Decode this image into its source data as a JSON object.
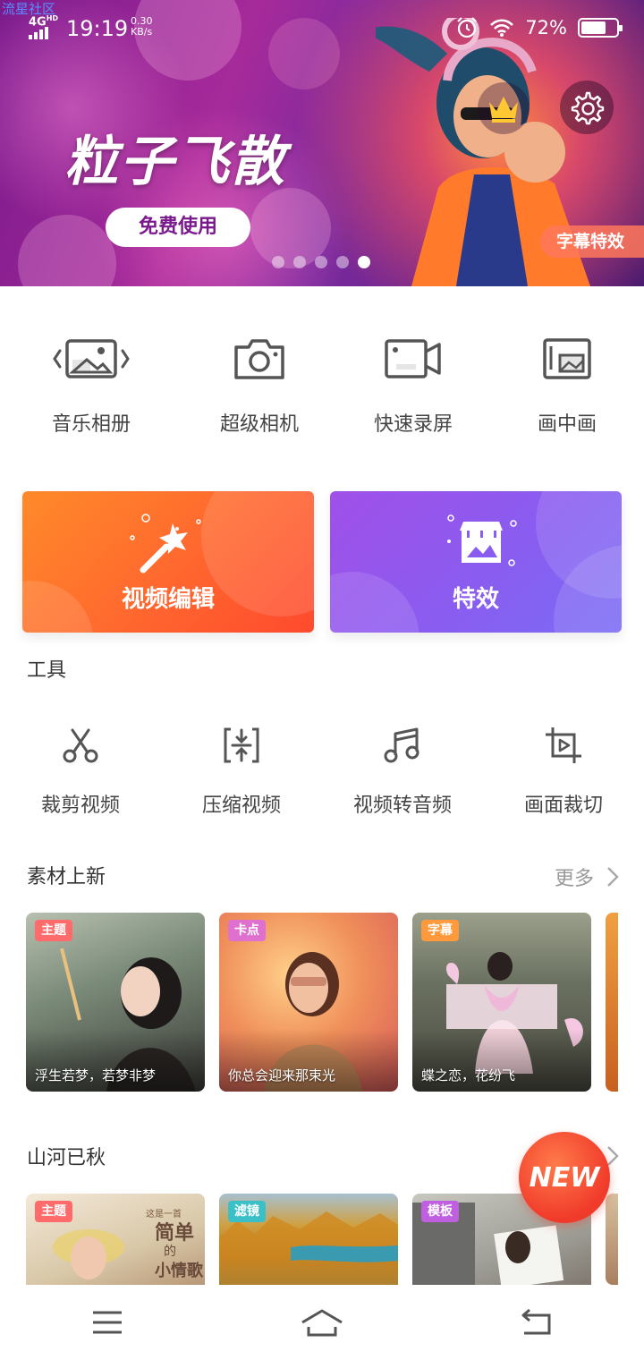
{
  "watermark": "流星社区",
  "status_bar": {
    "network": "4G",
    "network_sup": "HD",
    "time": "19:19",
    "speed_value": "0.30",
    "speed_unit": "KB/s",
    "battery": "72%",
    "battery_level": 0.72,
    "icons": [
      "signal-icon",
      "alarm-icon",
      "wifi-icon",
      "battery-icon"
    ]
  },
  "banner": {
    "title": "粒子飞散",
    "button": "免费使用",
    "tag": "字幕特效",
    "slide_count": 5,
    "active_slide": 5,
    "icons": [
      "crown-icon",
      "gear-icon"
    ]
  },
  "quick_tools": [
    {
      "label": "音乐相册",
      "icon": "music-album-icon"
    },
    {
      "label": "超级相机",
      "icon": "camera-icon"
    },
    {
      "label": "快速录屏",
      "icon": "screen-record-icon"
    },
    {
      "label": "画中画",
      "icon": "picture-in-picture-icon"
    }
  ],
  "feature_cards": [
    {
      "label": "视频编辑",
      "icon": "magic-wand-icon",
      "color": "#ff6a2e"
    },
    {
      "label": "特效",
      "icon": "store-icon",
      "color": "#8a5cf0"
    }
  ],
  "tools_section": {
    "title": "工具",
    "items": [
      {
        "label": "裁剪视频",
        "icon": "scissors-icon"
      },
      {
        "label": "压缩视频",
        "icon": "compress-icon"
      },
      {
        "label": "视频转音频",
        "icon": "music-note-icon"
      },
      {
        "label": "画面裁切",
        "icon": "crop-icon"
      }
    ]
  },
  "new_materials": {
    "title": "素材上新",
    "more": "更多",
    "items": [
      {
        "tag": "主题",
        "tag_color": "#ff6b6b",
        "caption": "浮生若梦，若梦非梦"
      },
      {
        "tag": "卡点",
        "tag_color": "#e070d0",
        "caption": "你总会迎来那束光"
      },
      {
        "tag": "字幕",
        "tag_color": "#ff9a3c",
        "caption": "蝶之恋，花纷飞"
      }
    ]
  },
  "autumn_section": {
    "title": "山河已秋",
    "items": [
      {
        "tag": "主题",
        "tag_color": "#ff6b6b",
        "overlay_line1": "这是一首",
        "overlay_line2": "简单",
        "overlay_line3": "的",
        "overlay_line4": "小情歌"
      },
      {
        "tag": "滤镜",
        "tag_color": "#3cc0c8"
      },
      {
        "tag": "模板",
        "tag_color": "#c060e0"
      }
    ]
  },
  "new_badge": "NEW",
  "nav": {
    "icons": [
      "menu-icon",
      "home-icon",
      "back-icon"
    ]
  }
}
